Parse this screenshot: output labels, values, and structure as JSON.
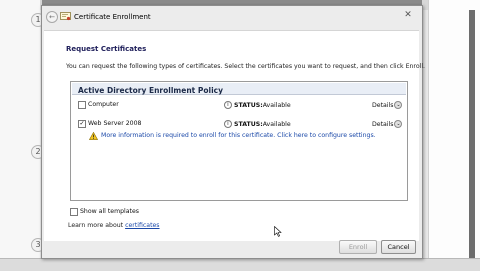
{
  "window": {
    "title": "Certificate Enrollment",
    "title_partial": "Certificate Enrollment"
  },
  "page": {
    "section_title": "Request Certificates",
    "instruction": "You can request the following types of certificates. Select the certificates you want to request, and then click Enroll."
  },
  "policy": {
    "title": "Active Directory Enrollment Policy",
    "rows": [
      {
        "label": "Computer",
        "checked": false,
        "status_key": "STATUS:",
        "status_value": "Available",
        "details": "Details"
      },
      {
        "label": "Web Server 2008",
        "checked": true,
        "status_key": "STATUS:",
        "status_value": "Available",
        "details": "Details"
      }
    ],
    "warning": "More information is required to enroll for this certificate. Click here to configure settings."
  },
  "options": {
    "show_all": "Show all templates",
    "learn_more_prefix": "Learn more about ",
    "learn_more_link": "certificates"
  },
  "buttons": {
    "enroll": "Enroll",
    "cancel": "Cancel"
  },
  "background": {
    "steps": [
      "1",
      "2",
      "3"
    ]
  }
}
